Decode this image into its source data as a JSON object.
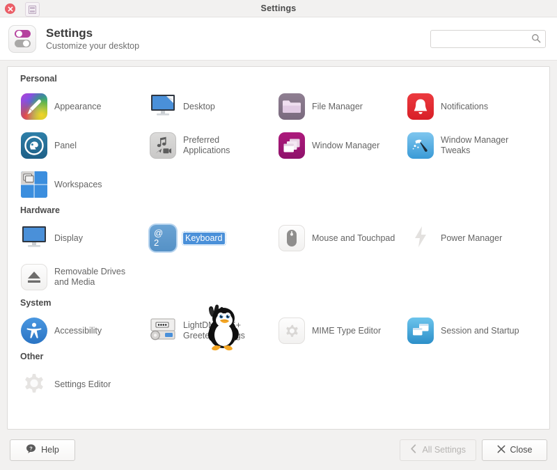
{
  "window": {
    "title": "Settings",
    "close_icon": "close-icon",
    "menu_icon": "window-menu-icon"
  },
  "header": {
    "title": "Settings",
    "subtitle": "Customize your desktop",
    "icon": "settings-toggles-icon"
  },
  "search": {
    "value": "",
    "placeholder": "",
    "icon": "search-icon"
  },
  "categories": [
    {
      "title": "Personal",
      "items": [
        {
          "label": "Appearance",
          "icon": "appearance-icon",
          "selected": false
        },
        {
          "label": "Desktop",
          "icon": "desktop-icon",
          "selected": false
        },
        {
          "label": "File Manager",
          "icon": "file-manager-icon",
          "selected": false
        },
        {
          "label": "Notifications",
          "icon": "notifications-icon",
          "selected": false
        },
        {
          "label": "Panel",
          "icon": "panel-icon",
          "selected": false
        },
        {
          "label": "Preferred Applications",
          "icon": "preferred-applications-icon",
          "selected": false
        },
        {
          "label": "Window Manager",
          "icon": "window-manager-icon",
          "selected": false
        },
        {
          "label": "Window Manager Tweaks",
          "icon": "window-manager-tweaks-icon",
          "selected": false
        },
        {
          "label": "Workspaces",
          "icon": "workspaces-icon",
          "selected": false
        }
      ]
    },
    {
      "title": "Hardware",
      "items": [
        {
          "label": "Display",
          "icon": "display-icon",
          "selected": false
        },
        {
          "label": "Keyboard",
          "icon": "keyboard-icon",
          "selected": true
        },
        {
          "label": "Mouse and Touchpad",
          "icon": "mouse-icon",
          "selected": false
        },
        {
          "label": "Power Manager",
          "icon": "power-bolt-icon",
          "selected": false
        },
        {
          "label": "Removable Drives and Media",
          "icon": "eject-icon",
          "selected": false
        }
      ]
    },
    {
      "title": "System",
      "items": [
        {
          "label": "Accessibility",
          "icon": "accessibility-icon",
          "selected": false
        },
        {
          "label": "LightDM GTK+ Greeter settings",
          "icon": "lightdm-greeter-icon",
          "selected": false
        },
        {
          "label": "MIME Type Editor",
          "icon": "gear-icon",
          "selected": false
        },
        {
          "label": "Session and Startup",
          "icon": "session-startup-icon",
          "selected": false
        }
      ]
    },
    {
      "title": "Other",
      "items": [
        {
          "label": "Settings Editor",
          "icon": "settings-editor-gear-icon",
          "selected": false
        }
      ]
    }
  ],
  "keyboard_icon_glyphs": {
    "top": "@",
    "bottom": "2"
  },
  "footer": {
    "help_label": "Help",
    "help_icon": "help-icon",
    "all_settings_label": "All Settings",
    "all_settings_icon": "chevron-left-icon",
    "all_settings_disabled": true,
    "close_label": "Close",
    "close_icon": "x-icon"
  },
  "cursor": {
    "type": "penguin-cursor"
  },
  "colors": {
    "selection_blue": "#4a90d9",
    "accent_magenta": "#b5429e",
    "titlebar_bg": "#f2f1f0",
    "content_bg": "#ffffff",
    "text": "#646464"
  }
}
